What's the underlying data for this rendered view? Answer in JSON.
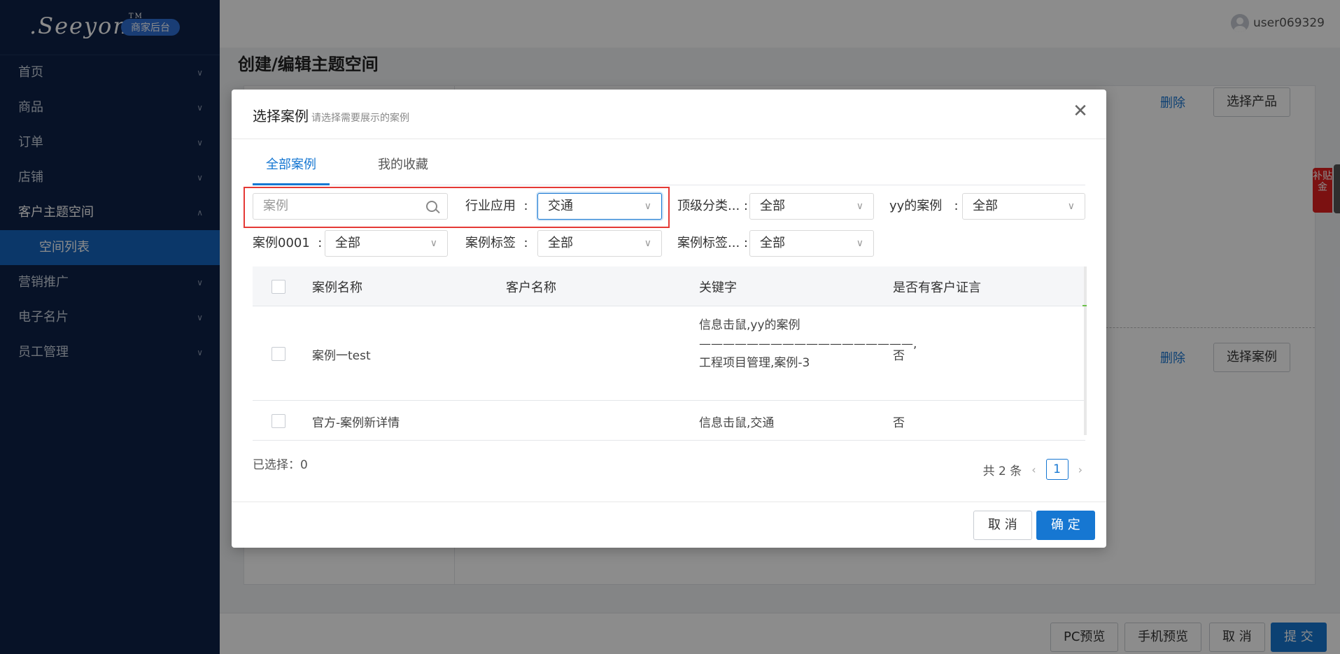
{
  "brand": {
    "logo_text": ".Seeyon",
    "tm": "TM",
    "badge": "商家后台"
  },
  "sidebar": {
    "items": [
      {
        "label": "首页"
      },
      {
        "label": "商品"
      },
      {
        "label": "订单"
      },
      {
        "label": "店铺"
      },
      {
        "label": "客户主题空间",
        "expanded": true
      },
      {
        "label": "空间列表",
        "active": true
      },
      {
        "label": "营销推广"
      },
      {
        "label": "电子名片"
      },
      {
        "label": "员工管理"
      }
    ]
  },
  "header": {
    "username": "user069329"
  },
  "page": {
    "title": "创建/编辑主题空间",
    "delete_label_1": "删除",
    "select_product_label": "选择产品",
    "delete_label_2": "删除",
    "select_case_label": "选择案例",
    "reward_label": "补贴金"
  },
  "footer": {
    "pc_preview": "PC预览",
    "mobile_preview": "手机预览",
    "cancel": "取 消",
    "submit": "提 交"
  },
  "modal": {
    "title": "选择案例",
    "subtitle": "请选择需要展示的案例",
    "close_icon": "close-icon",
    "tabs": [
      {
        "label": "全部案例",
        "active": true
      },
      {
        "label": "我的收藏"
      }
    ],
    "filters": {
      "search_placeholder": "案例",
      "industry_label": "行业应用",
      "industry_value": "交通",
      "top_category_label": "顶级分类...",
      "top_category_value": "全部",
      "yy_label": "yy的案例",
      "yy_value": "全部",
      "case0001_label": "案例0001",
      "case0001_value": "全部",
      "case_tag_label": "案例标签",
      "case_tag_value": "全部",
      "case_tag2_label": "案例标签...",
      "case_tag2_value": "全部",
      "colon": ":"
    },
    "table": {
      "headers": [
        "案例名称",
        "客户名称",
        "关键字",
        "是否有客户证言"
      ],
      "rows": [
        {
          "name": "案例一test",
          "customer": "",
          "keywords": "信息击鼠,yy的案例——————————————————,工程项目管理,案例-3",
          "testimonial": "否"
        },
        {
          "name": "官方-案例新详情",
          "customer": "",
          "keywords": "信息击鼠,交通",
          "testimonial": "否"
        }
      ]
    },
    "selected_text": "已选择：0",
    "pagination": {
      "total_text": "共 2 条",
      "current_page": "1"
    },
    "buttons": {
      "cancel": "取 消",
      "confirm": "确 定"
    }
  },
  "colors": {
    "sidebar_bg": "#0d2147",
    "primary": "#1677d2",
    "highlight_border": "#e53935"
  }
}
